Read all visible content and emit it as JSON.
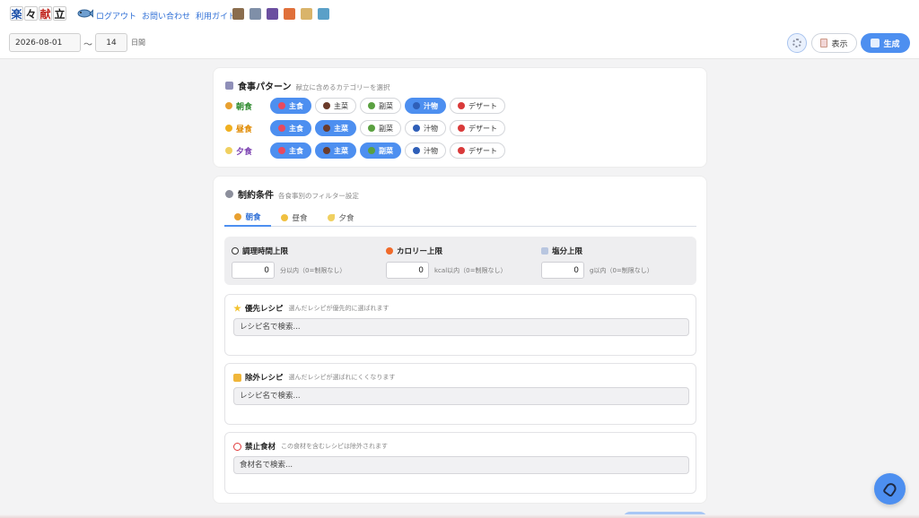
{
  "app": {
    "logo_chars": [
      "楽",
      "々",
      "献",
      "立"
    ],
    "nav_links": [
      "ログアウト",
      "お問い合わせ",
      "利用ガイド"
    ],
    "toolbar_icons": [
      "bowl-icon",
      "calendar-icon",
      "book-icon",
      "fire-icon",
      "scroll-icon",
      "image-icon"
    ]
  },
  "controls": {
    "start_date": "2026-08-01",
    "tilde": "〜",
    "days": "14",
    "days_unit": "日間",
    "view_label": "表示",
    "generate_label": "生成"
  },
  "meal_pattern": {
    "title": "食事パターン",
    "subtitle": "献立に含めるカテゴリーを選択",
    "category_labels": [
      "主食",
      "主菜",
      "副菜",
      "汁物",
      "デザート"
    ],
    "rows": [
      {
        "label": "朝食",
        "color": "#2e8b2e",
        "selected": [
          true,
          false,
          false,
          true,
          false
        ]
      },
      {
        "label": "昼食",
        "color": "#e08a00",
        "selected": [
          true,
          true,
          false,
          false,
          false
        ]
      },
      {
        "label": "夕食",
        "color": "#7a3fb0",
        "selected": [
          true,
          true,
          true,
          false,
          false
        ]
      }
    ]
  },
  "constraints": {
    "title": "制約条件",
    "subtitle": "各食事別のフィルター設定",
    "tabs": [
      "朝食",
      "昼食",
      "夕食"
    ],
    "active_tab": 0,
    "limits": [
      {
        "label": "調理時間上限",
        "value": "0",
        "unit": "分以内（0=制限なし）"
      },
      {
        "label": "カロリー上限",
        "value": "0",
        "unit": "kcal以内（0=制限なし）"
      },
      {
        "label": "塩分上限",
        "value": "0",
        "unit": "g以内（0=制限なし）"
      }
    ],
    "priority": {
      "title": "優先レシピ",
      "desc": "選んだレシピが優先的に選ばれます",
      "placeholder": "レシピ名で検索..."
    },
    "exclude": {
      "title": "除外レシピ",
      "desc": "選んだレシピが選ばれにくくなります",
      "placeholder": "レシピ名で検索..."
    },
    "forbidden": {
      "title": "禁止食材",
      "desc": "この食材を含むレシピは除外されます",
      "placeholder": "食材名で検索..."
    }
  },
  "colors": {
    "accent": "#4d8ff0",
    "link": "#2f6fd6"
  }
}
